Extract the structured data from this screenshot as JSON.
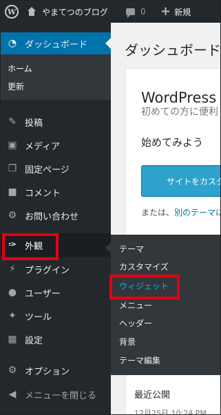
{
  "adminbar": {
    "site_name": "やまてつのブログ",
    "comment_count": "0",
    "new_label": "新規"
  },
  "sidebar": {
    "dashboard": "ダッシュボード",
    "dashboard_sub": [
      "ホーム",
      "更新"
    ],
    "items": [
      {
        "label": "投稿",
        "icon": "pin-icon"
      },
      {
        "label": "メディア",
        "icon": "media-icon"
      },
      {
        "label": "固定ページ",
        "icon": "page-icon"
      },
      {
        "label": "コメント",
        "icon": "comment-icon"
      },
      {
        "label": "お問い合わせ",
        "icon": "gear-icon"
      },
      {
        "label": "外観",
        "icon": "brush-icon"
      },
      {
        "label": "プラグイン",
        "icon": "plugin-icon"
      },
      {
        "label": "ユーザー",
        "icon": "user-icon"
      },
      {
        "label": "ツール",
        "icon": "wrench-icon"
      },
      {
        "label": "設定",
        "icon": "settings-icon"
      },
      {
        "label": "オプション",
        "icon": "gear-icon"
      },
      {
        "label": "メニューを閉じる",
        "icon": "collapse-icon"
      }
    ]
  },
  "flyout": [
    "テーマ",
    "カスタマイズ",
    "ウィジェット",
    "メニュー",
    "ヘッダー",
    "背景",
    "テーマ編集"
  ],
  "main": {
    "title": "ダッシュボード",
    "welcome_title": "WordPress へ",
    "welcome_sub": "初めての方に便利",
    "getting_started": "始めてみよう",
    "customize_btn": "サイトをカスタ",
    "or_prefix": "または、",
    "or_link": "別のテーマに",
    "recent_title": "最近公開",
    "recent_date": "12月25日 10:24 PM"
  },
  "colors": {
    "adminbar_bg": "#23282d",
    "active_blue": "#0073aa",
    "highlight_red": "#e60012",
    "button_blue": "#2ea2cc"
  }
}
